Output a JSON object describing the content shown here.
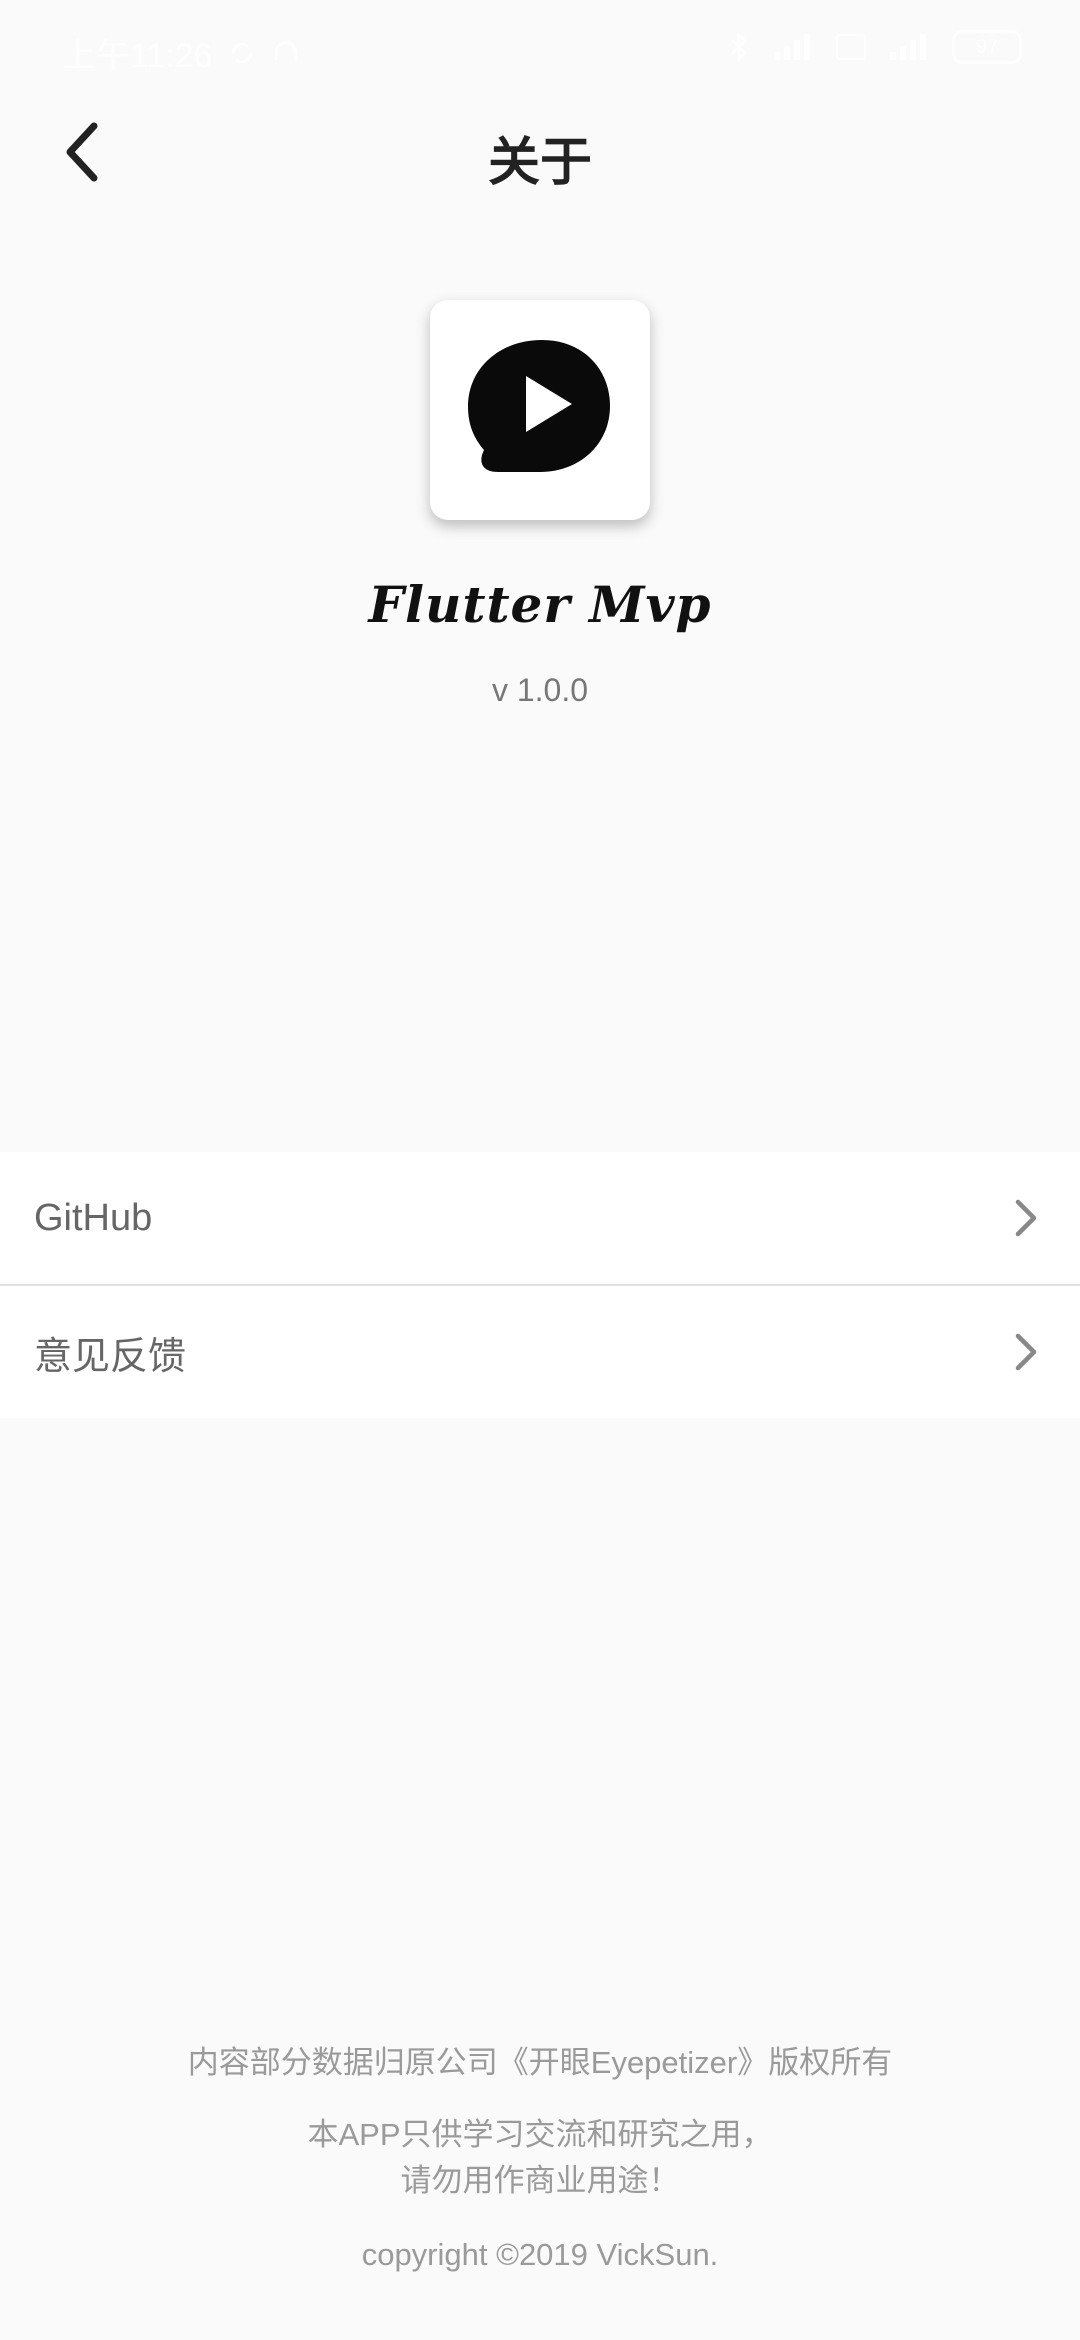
{
  "status_bar": {
    "time": "上午11:26",
    "battery": "97"
  },
  "app_bar": {
    "title": "关于"
  },
  "app_info": {
    "name": "Flutter Mvp",
    "version": "v 1.0.0"
  },
  "menu": {
    "items": [
      {
        "label": "GitHub"
      },
      {
        "label": "意见反馈"
      }
    ]
  },
  "footer": {
    "line1": "内容部分数据归原公司《开眼Eyepetizer》版权所有",
    "line2": "本APP只供学习交流和研究之用，",
    "line3": "请勿用作商业用途！",
    "copyright": "copyright ©2019 VickSun."
  }
}
